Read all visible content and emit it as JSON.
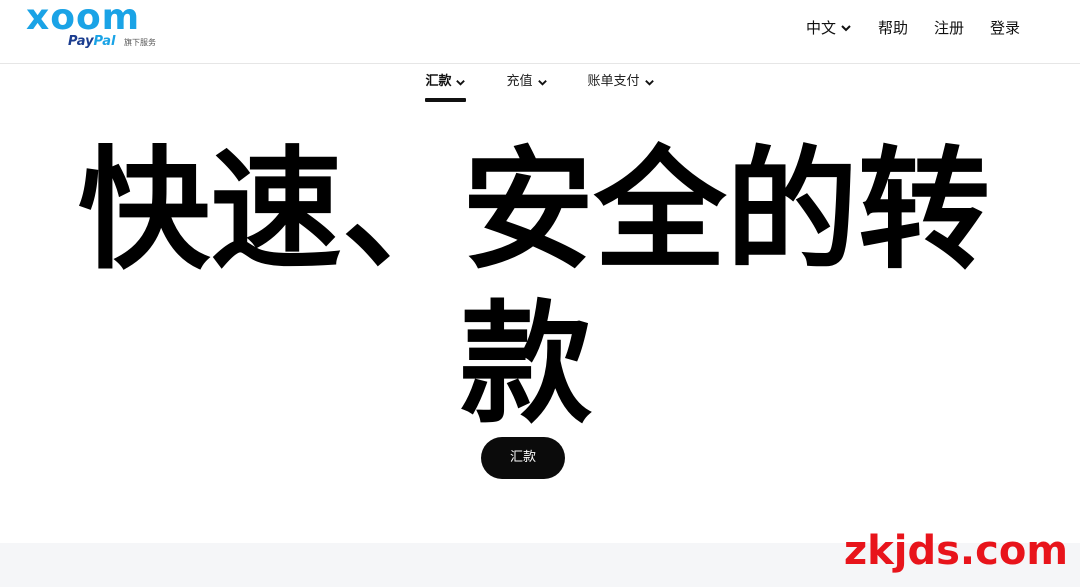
{
  "header": {
    "logo": {
      "brand": "xoom",
      "sub_brand_pay": "Pay",
      "sub_brand_pal": "Pal",
      "sub_brand_note": "旗下服务"
    },
    "nav": [
      {
        "label": "中文",
        "has_dropdown": true
      },
      {
        "label": "帮助"
      },
      {
        "label": "注册"
      },
      {
        "label": "登录"
      }
    ]
  },
  "sub_nav": {
    "tabs": [
      {
        "label": "汇款",
        "active": true
      },
      {
        "label": "充值",
        "active": false
      },
      {
        "label": "账单支付",
        "active": false
      }
    ]
  },
  "hero": {
    "title_line1_a": "快速、",
    "title_line1_b": "安全的转",
    "title_line2": "款",
    "cta_label": "汇款"
  },
  "watermark": "zkjds.com",
  "colors": {
    "brand_blue": "#1aa3e6",
    "paypal_navy": "#1b3d8f",
    "cta_bg": "#0b0b0b",
    "watermark_red": "#e8141b"
  }
}
